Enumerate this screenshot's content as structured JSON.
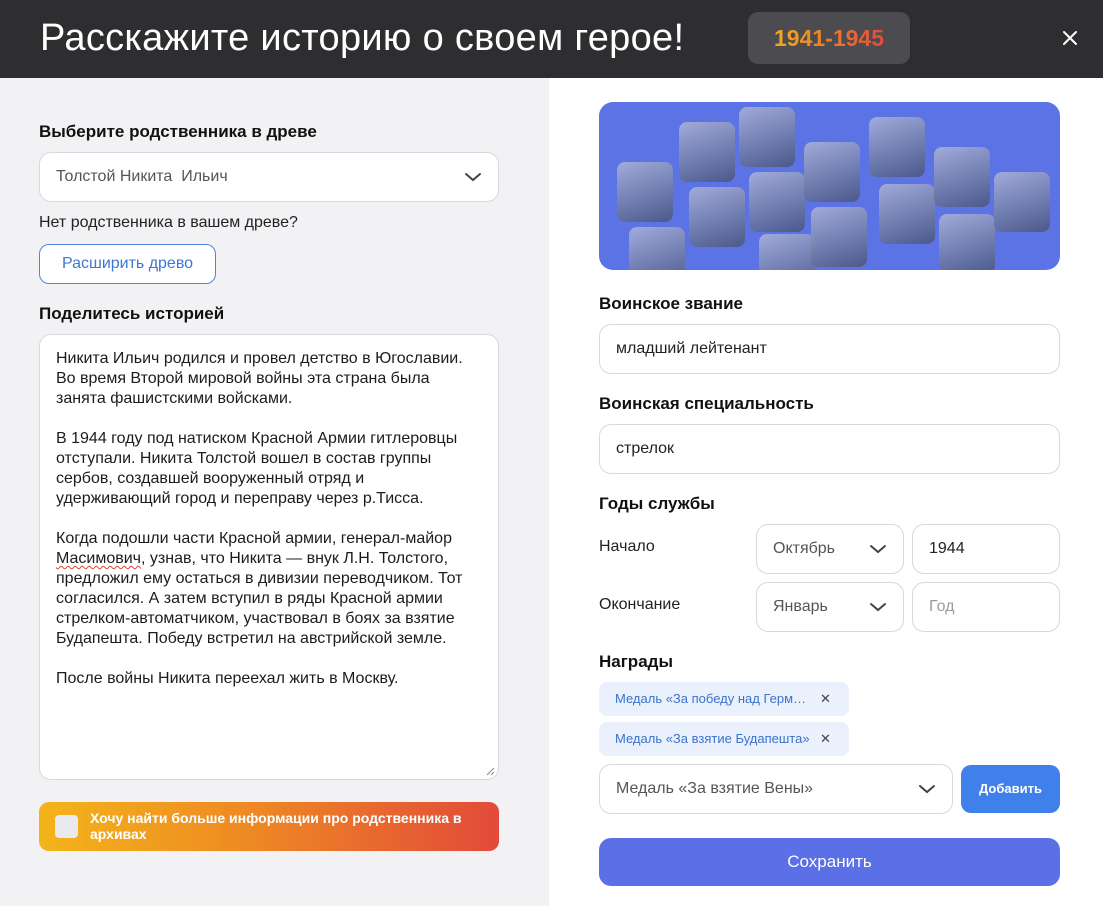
{
  "header": {
    "title": "Расскажите историю о своем герое!",
    "years_badge": "1941-1945",
    "close_icon": "close-icon"
  },
  "left": {
    "relative_label": "Выберите родственника в древе",
    "relative_value": "Толстой Никита  Ильич",
    "no_relative_text": "Нет родственника в вашем древе?",
    "expand_tree_button": "Расширить древо",
    "story_label": "Поделитесь историей",
    "story_parts": {
      "p1": "Никита Ильич родился и провел детство в Югославии. Во время Второй мировой войны эта страна была занята фашистскими войсками.\n\nВ 1944 году под натиском Красной Армии гитлеровцы отступали. Никита Толстой вошел в состав группы сербов, создавшей вооруженный отряд и удерживающий город и переправу через р.Тисса.\n\nКогда подошли части Красной армии, генерал-майор ",
      "misspelled": "Масимович",
      "p2": ", узнав, что Никита — внук Л.Н. Толстого, предложил ему остаться в дивизии переводчиком. Тот согласился. А затем вступил в ряды Красной армии стрелком-автоматчиком, участвовал в боях за взятие Будапешта. Победу встретил на австрийской земле.\n\nПосле войны Никита переехал жить в Москву."
    },
    "archive_checkbox_label": "Хочу найти больше информации про родственника в архивах",
    "archive_checked": false
  },
  "right": {
    "rank_label": "Воинское звание",
    "rank_value": "младший лейтенант",
    "specialty_label": "Воинская специальность",
    "specialty_value": "стрелок",
    "service_years_label": "Годы службы",
    "start_label": "Начало",
    "start_month": "Октябрь",
    "start_year": "1944",
    "end_label": "Окончание",
    "end_month": "Январь",
    "end_year_placeholder": "Год",
    "awards_label": "Награды",
    "awards": [
      "Медаль «За победу над Германией»",
      "Медаль «За взятие Будапешта»"
    ],
    "award_select_value": "Медаль «За взятие Вены»",
    "add_button": "Добавить",
    "save_button": "Сохранить"
  },
  "colors": {
    "header_bg": "#2e2e31",
    "accent_blue": "#3f80ea",
    "save_button": "#5b6fe6",
    "banner": "#5c73e6",
    "archive_gradient_start": "#f3b41a",
    "archive_gradient_end": "#e24a3a"
  }
}
